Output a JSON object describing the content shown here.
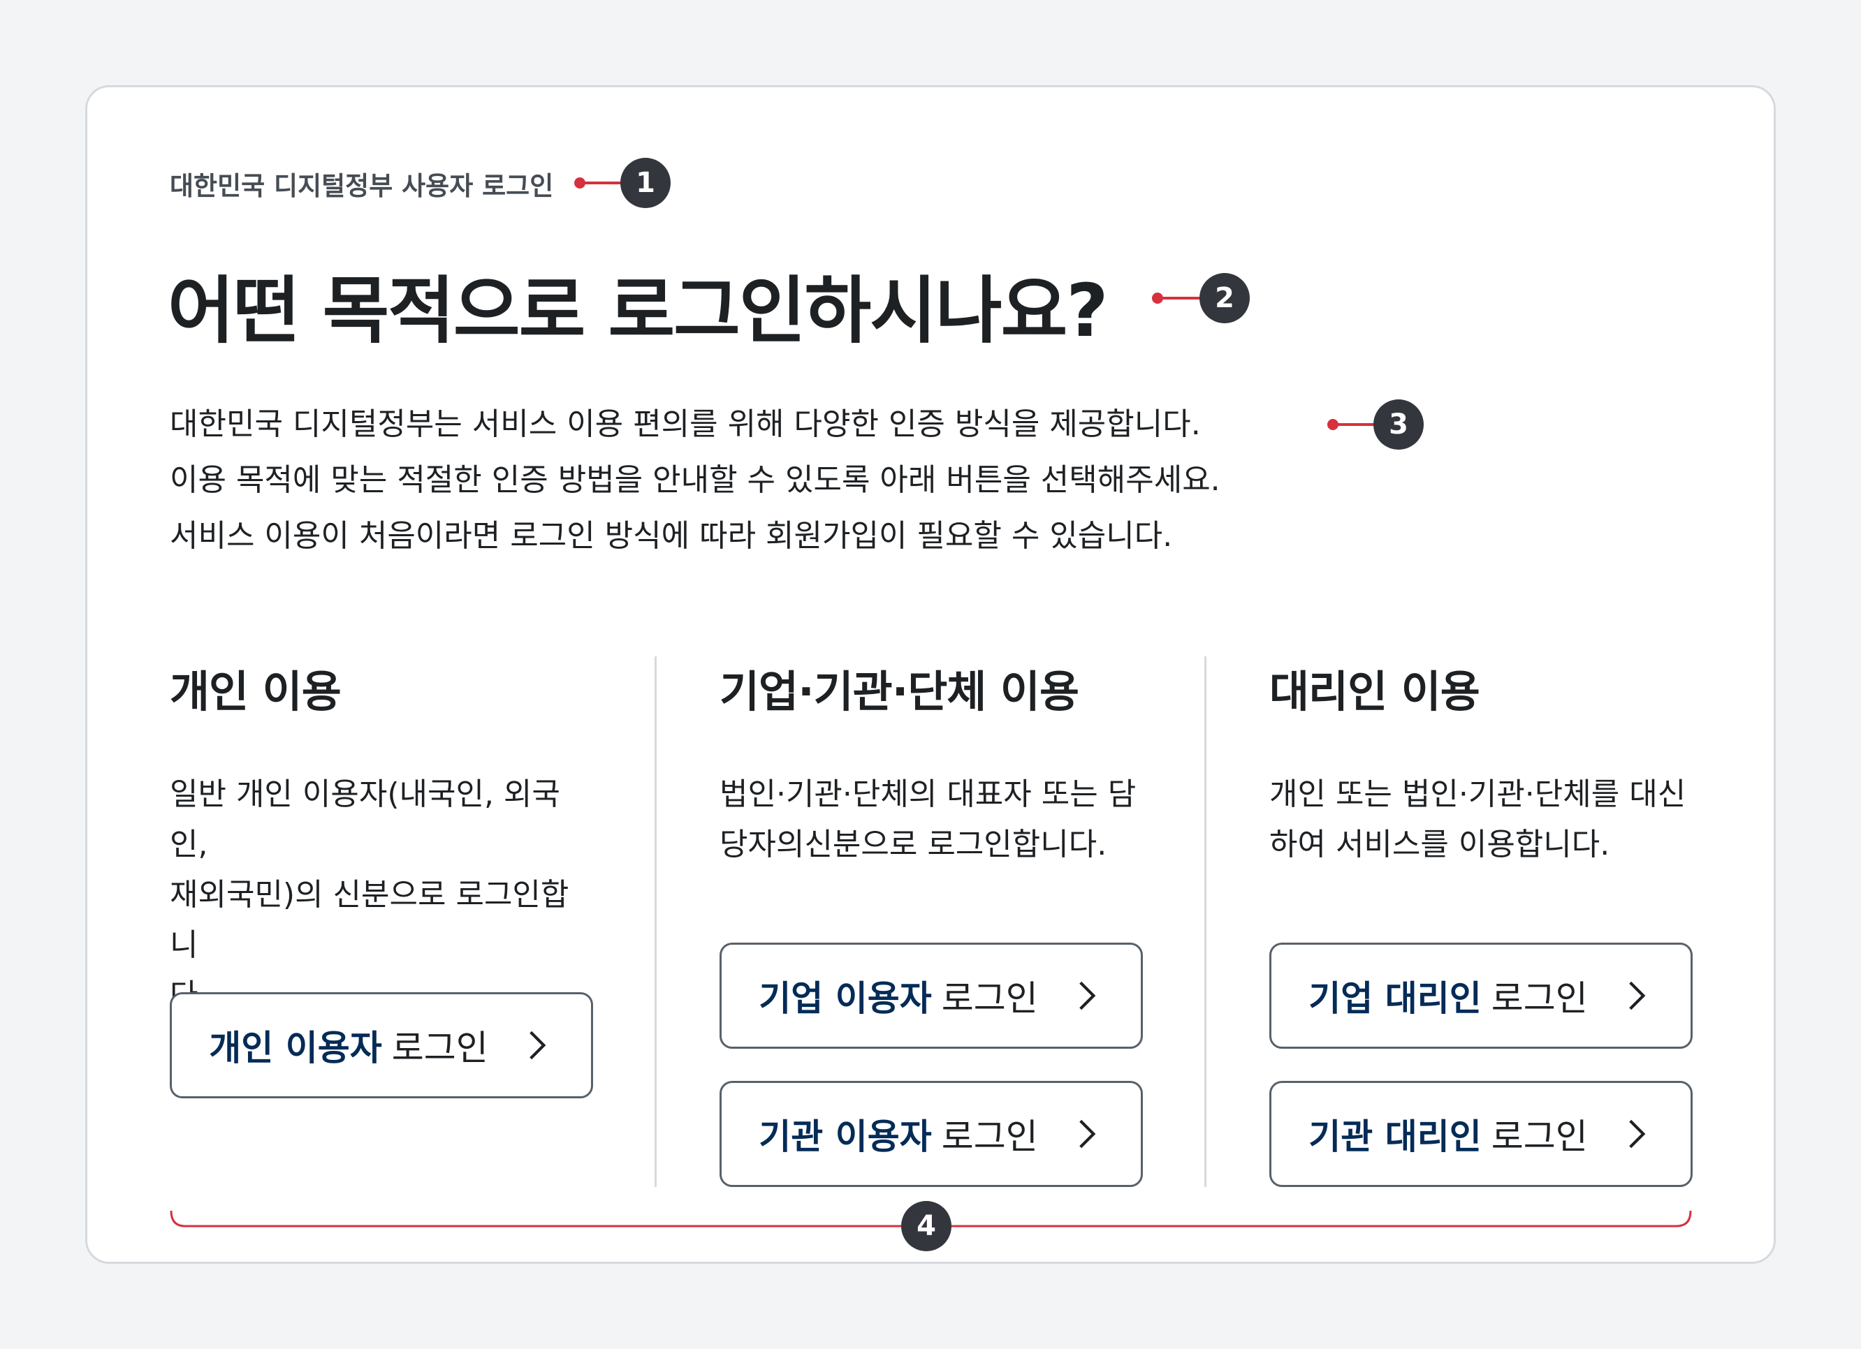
{
  "header": {
    "eyebrow": "대한민국 디지털정부 사용자 로그인",
    "title": "어떤 목적으로 로그인하시나요?"
  },
  "intro": {
    "lines": [
      "대한민국 디지털정부는 서비스 이용 편의를 위해 다양한 인증 방식을 제공합니다.",
      "이용 목적에 맞는 적절한 인증 방법을 안내할 수 있도록 아래 버튼을 선택해주세요.",
      "서비스 이용이 처음이라면 로그인 방식에 따라 회원가입이 필요할 수 있습니다."
    ]
  },
  "columns": [
    {
      "title": "개인 이용",
      "description": "일반 개인 이용자(내국인, 외국인,\n재외국민)의 신분으로 로그인합니\n다.",
      "buttons": [
        {
          "bold": "개인 이용자",
          "rest": "로그인"
        }
      ]
    },
    {
      "title": "기업·기관·단체 이용",
      "description": "법인·기관·단체의 대표자 또는 담\n당자의신분으로 로그인합니다.",
      "buttons": [
        {
          "bold": "기업 이용자",
          "rest": "로그인"
        },
        {
          "bold": "기관 이용자",
          "rest": "로그인"
        }
      ]
    },
    {
      "title": "대리인 이용",
      "description": "개인 또는 법인·기관·단체를 대신\n하여 서비스를 이용합니다.",
      "buttons": [
        {
          "bold": "기업 대리인",
          "rest": "로그인"
        },
        {
          "bold": "기관 대리인",
          "rest": "로그인"
        }
      ]
    }
  ],
  "annotations": [
    "1",
    "2",
    "3",
    "4"
  ],
  "colors": {
    "accent": "#d6313d",
    "navy": "#052b57",
    "badge": "#33363d"
  }
}
